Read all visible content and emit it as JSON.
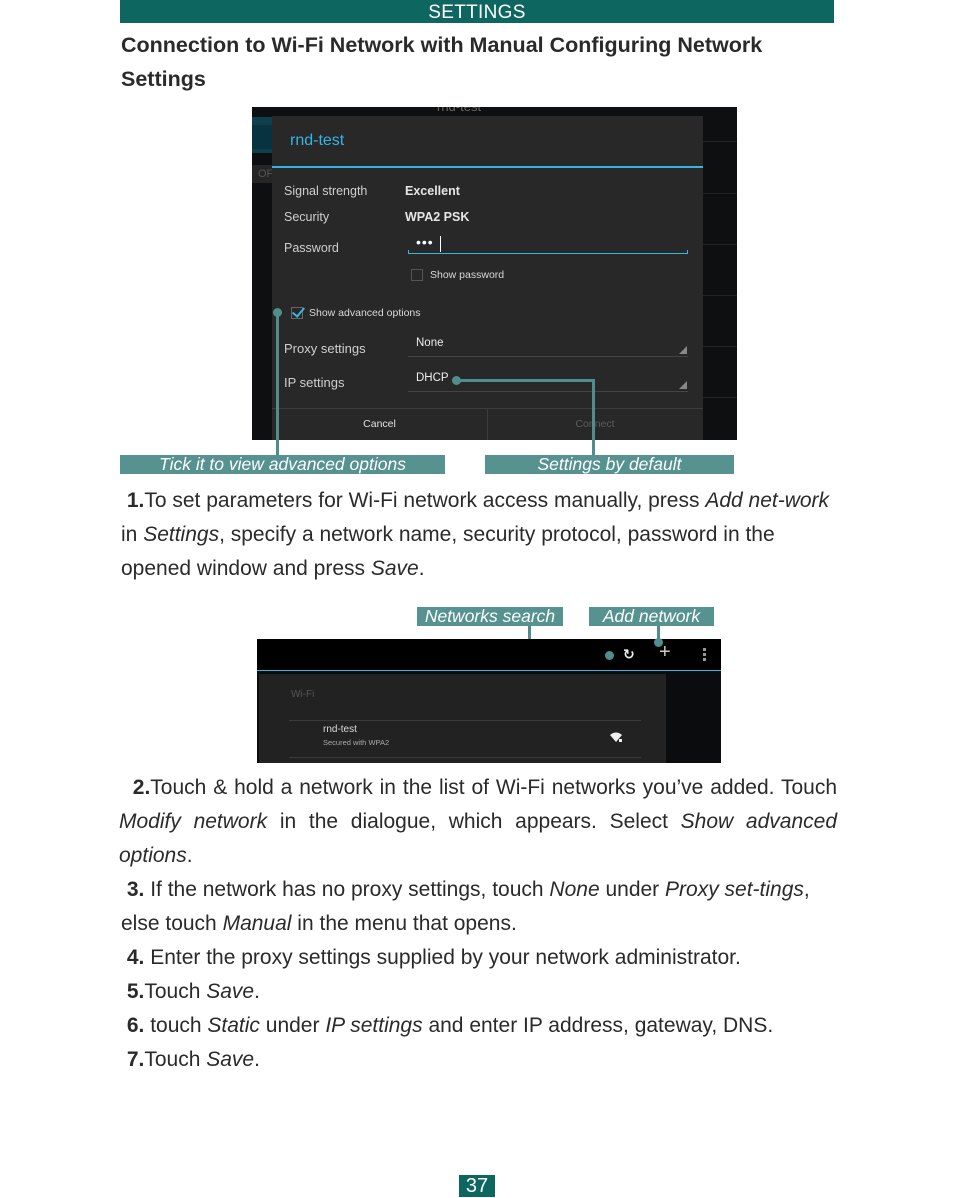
{
  "header": {
    "section": "SETTINGS"
  },
  "page_title": "Connection to Wi-Fi Network with Manual Configuring Network Settings",
  "screenshot1": {
    "background_title": "rnd-test",
    "background_off": "OF",
    "dialog": {
      "title": "rnd-test",
      "rows": [
        {
          "label": "Signal strength",
          "value": "Excellent"
        },
        {
          "label": "Security",
          "value": "WPA2 PSK"
        },
        {
          "label": "Password",
          "value": "•••"
        }
      ],
      "show_password": {
        "label": "Show password",
        "checked": false
      },
      "show_advanced": {
        "label": "Show advanced options",
        "checked": true
      },
      "proxy_settings": {
        "label": "Proxy settings",
        "value": "None"
      },
      "ip_settings": {
        "label": "IP settings",
        "value": "DHCP"
      },
      "buttons": {
        "cancel": "Cancel",
        "connect": "Connect"
      }
    },
    "accent_color": "#33b5e5"
  },
  "callouts1": {
    "advanced": "Tick it to view advanced options",
    "default": "Settings by default"
  },
  "steps": {
    "s1": {
      "num": "1.",
      "t1": "To set parameters for Wi-Fi network access manually, press ",
      "i1": "Add net-work",
      "t2": " in ",
      "i2": "Settings",
      "t3": ", specify a network name, security protocol, password in the opened window and press ",
      "i3": "Save",
      "t4": "."
    },
    "s2": {
      "num": "2.",
      "t1": "Touch & hold a network in the list of Wi-Fi networks you’ve added. Touch ",
      "i1": "Modify network",
      "t2": " in the dialogue, which appears. Select ",
      "i2": "Show advanced options",
      "t3": "."
    },
    "s3": {
      "num": "3.",
      "t1": " If the network has no proxy settings, touch ",
      "i1": "None",
      "t2": " under ",
      "i2": "Proxy set-tings",
      "t3": ", else touch ",
      "i3": "Manual",
      "t4": " in the menu that opens."
    },
    "s4": {
      "num": "4.",
      "t1": " Enter the proxy settings supplied by your network administrator."
    },
    "s5": {
      "num": "5.",
      "t1": "Touch ",
      "i1": "Save",
      "t2": "."
    },
    "s6": {
      "num": "6.",
      "t1": " touch ",
      "i1": "Static",
      "t2": " under ",
      "i2": "IP settings",
      "t3": " and enter IP address, gateway, DNS."
    },
    "s7": {
      "num": "7.",
      "t1": "Touch ",
      "i1": "Save",
      "t2": "."
    }
  },
  "callouts2": {
    "search": "Networks search",
    "add": "Add network"
  },
  "screenshot2": {
    "section_header": "Wi-Fi",
    "networks": [
      {
        "name": "rnd-test",
        "status": "Secured with WPA2",
        "icon": "wifi-locked-icon"
      }
    ],
    "action_icons": [
      "refresh-icon",
      "add-icon",
      "overflow-menu-icon"
    ]
  },
  "page_number": "37",
  "colors": {
    "brand": "#0e6660",
    "callout": "#569290"
  }
}
